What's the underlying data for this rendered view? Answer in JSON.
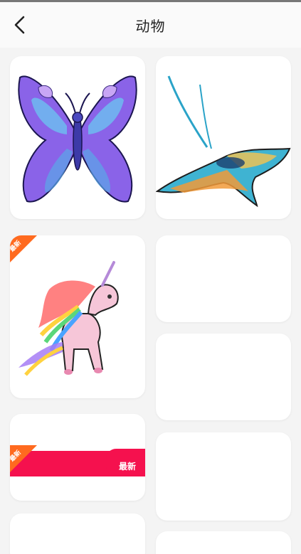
{
  "header": {
    "title": "动物",
    "back_icon": "chevron-left-icon"
  },
  "cards": [
    {
      "name": "butterfly",
      "badge": ""
    },
    {
      "name": "manta-ray",
      "badge": ""
    },
    {
      "name": "unicorn",
      "badge": "最新"
    },
    {
      "name": "blank",
      "badge": ""
    },
    {
      "name": "banner",
      "badge": "最新",
      "banner_label": "最新"
    },
    {
      "name": "blank",
      "badge": ""
    },
    {
      "name": "blank",
      "badge": ""
    },
    {
      "name": "blank",
      "badge": ""
    }
  ],
  "colors": {
    "accent_badge": "#ff6a1f",
    "banner": "#f5114e"
  }
}
